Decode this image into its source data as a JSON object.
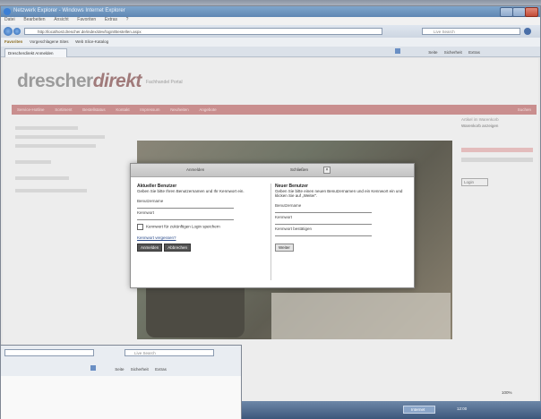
{
  "window": {
    "title": "Netzwerk Explorer - Windows Internet Explorer",
    "menu": [
      "Datei",
      "Bearbeiten",
      "Ansicht",
      "Favoriten",
      "Extras",
      "?"
    ],
    "address": "http://localhost:drescher.de/index/dev/login/Bestellen.aspx",
    "search_placeholder": "Live Search",
    "favorites_label": "Favoriten",
    "fav_items": [
      "Vorgeschlagene Sites",
      "Web Slice-Katalog"
    ],
    "tab_label": "Drescherdirekt Anmelden",
    "command_bar": [
      "Seite",
      "Sicherheit",
      "Extras"
    ]
  },
  "page": {
    "logo_main": "drescher",
    "logo_accent": "direkt",
    "logo_sub": "Fachhandel Portal",
    "nav_items": [
      "Service-Hotline",
      "Sortiment",
      "Bestellstatus",
      "Kontakt",
      "Impressum",
      "Neuheiten",
      "Angebote"
    ],
    "nav_right": "Suchen",
    "right_title": "Artikel im Warenkorb",
    "right_sub": "Warenkorb anzeigen",
    "right_btn": "Login",
    "below_line1": "drescherdirekt",
    "below_line2": "Portal"
  },
  "dialog": {
    "tab_label": "Anmelden",
    "close_label": "Schließen",
    "close_x": "×",
    "left": {
      "heading": "Aktueller Benutzer",
      "desc": "Geben Sie bitte Ihren Benutzernamen und Ihr Kennwort ein.",
      "field1": "Benutzername",
      "field2": "Kennwort",
      "checkbox": "Kennwort für zukünftigen Login speichern",
      "link": "Kennwort vergessen?",
      "btn_login": "Anmelden",
      "btn_cancel": "Abbrechen"
    },
    "right": {
      "heading": "Neuer Benutzer",
      "desc": "Geben Sie bitte einen neuen Benutzernamen und ein Kennwort ein und klicken Sie auf „Weiter“.",
      "field1": "Benutzername",
      "field2": "Kennwort",
      "field3": "Kennwort bestätigen",
      "btn_next": "Weiter"
    }
  },
  "second_window": {
    "search_placeholder": "Live Search",
    "command_bar": [
      "Seite",
      "Sicherheit",
      "Extras"
    ]
  },
  "taskbar": {
    "task": "Internet",
    "zoom": "100%",
    "clock": "12:00"
  }
}
